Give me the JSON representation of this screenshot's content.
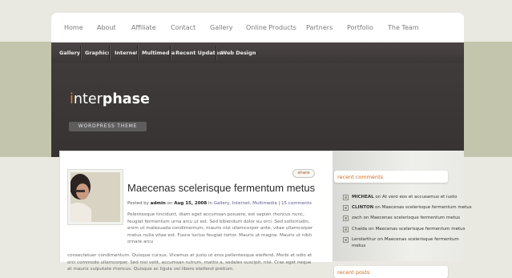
{
  "top_nav": [
    "Home",
    "About",
    "Affiliate",
    "Contact",
    "Gallery",
    "Online Products",
    "Partners",
    "Portfolio",
    "The Team"
  ],
  "sub_nav": [
    "Gallery",
    "Graphics",
    "Internet",
    "Multimedia",
    "Recent Updates",
    "Web Design"
  ],
  "logo": {
    "i": "i",
    "nter": "nter",
    "phase": "phase",
    "tagline": "WORDPRESS THEME"
  },
  "post": {
    "share": "share",
    "title": "Maecenas scelerisque fermentum metus",
    "meta_posted_by": "Posted by",
    "meta_author": "admin",
    "meta_on": "on",
    "meta_date": "Aug 15, 2008",
    "meta_in": "in",
    "meta_categories": "Gallery, Internet, Multimedia",
    "meta_sep": "|",
    "meta_comments": "15 comments",
    "body_1": "Pelentesque tincidunt, diam eget accumsan posuere, est sapien rhoncus nunc, feugiat fermentum urna arcu ut est. Sed bibendum dolor eu orci. Sed sollicitudin, enim ut malesuada condimentum, mauris nisl ullamcorper ante, vitae ullamcorper metus nulla vitae est. Fusce luctus feugiat tortor. Mauris ut magna. Mauris ut nibh ornare arcu",
    "body_2": "consectetuer condimentum. Quisque cursus. Vivamus at justo ut eros pellentesque eleifend. Morbi et odio et orci commodo ullamcorper. Sed nisl velit, accumsan rutrum, mattis a, sodales suscipit, nisl. Cras eget neque at mauris vulputate rhoncus. Quisque ac ligula vel libero eleifend pretium."
  },
  "sidebar": {
    "recent_comments_title": "recent comments",
    "comments": [
      {
        "author": "MICHEAL",
        "text": " on At vero eos et accusamus et iusto"
      },
      {
        "author": "CLINTON",
        "text": " on Maecenas scelerisque fermentum metus"
      },
      {
        "author": "zach",
        "text": " on Maecenas scelerisque fermentum metus"
      },
      {
        "author": "Chaida",
        "text": " on Maecenas scelerisque fermentum metus"
      },
      {
        "author": "Lerolarthur",
        "text": " on Maecenas scelerisque fermentum metus"
      }
    ],
    "recent_posts_title": "recent posts"
  }
}
